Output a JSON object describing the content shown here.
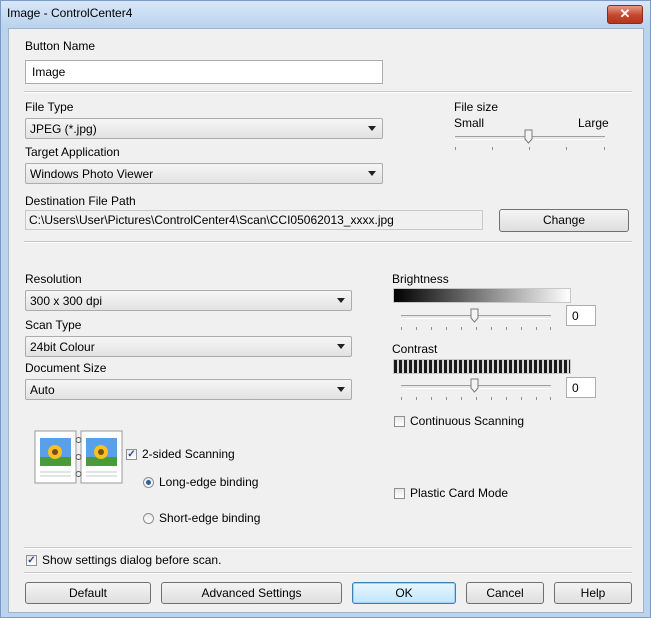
{
  "window": {
    "title": "Image - ControlCenter4",
    "close_glyph": "✕"
  },
  "button_name": {
    "label": "Button Name",
    "value": "Image"
  },
  "file_type": {
    "label": "File Type",
    "value": "JPEG (*.jpg)"
  },
  "file_size": {
    "label": "File size",
    "small": "Small",
    "large": "Large",
    "level": 0.5
  },
  "target_app": {
    "label": "Target Application",
    "value": "Windows Photo Viewer"
  },
  "destination": {
    "label": "Destination File Path",
    "value": "C:\\Users\\User\\Pictures\\ControlCenter4\\Scan\\CCI05062013_xxxx.jpg",
    "change_label": "Change"
  },
  "resolution": {
    "label": "Resolution",
    "value": "300 x 300 dpi"
  },
  "scan_type": {
    "label": "Scan Type",
    "value": "24bit Colour"
  },
  "document_size": {
    "label": "Document Size",
    "value": "Auto"
  },
  "brightness": {
    "label": "Brightness",
    "value": "0",
    "level": 0.5
  },
  "contrast": {
    "label": "Contrast",
    "value": "0",
    "level": 0.5
  },
  "continuous_scanning": {
    "label": "Continuous Scanning",
    "checked": false
  },
  "two_sided": {
    "label": "2-sided Scanning",
    "checked": true,
    "check_glyph": "✓"
  },
  "long_edge": {
    "label": "Long-edge binding",
    "selected": true
  },
  "short_edge": {
    "label": "Short-edge binding",
    "selected": false
  },
  "plastic_card": {
    "label": "Plastic Card Mode",
    "checked": false
  },
  "show_settings": {
    "label": "Show settings dialog before scan.",
    "checked": true,
    "check_glyph": "✓"
  },
  "buttons": {
    "default": "Default",
    "advanced": "Advanced Settings",
    "ok": "OK",
    "cancel": "Cancel",
    "help": "Help"
  },
  "colors": {
    "title_bg": "#bcd3ee",
    "client_bg": "#f0f0f0",
    "close_red": "#c4462d",
    "default_btn_border": "#3c7fb1"
  }
}
